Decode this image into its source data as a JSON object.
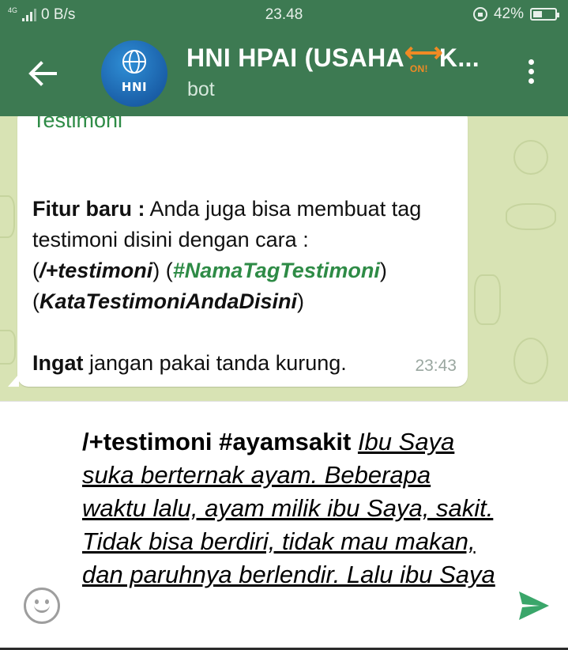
{
  "status_bar": {
    "network": "4G",
    "data_rate": "0 B/s",
    "time": "23.48",
    "battery": "42%",
    "battery_level": 0.42
  },
  "toolbar": {
    "title_before": "HNI HPAI (USAHA",
    "title_badge": "ON!",
    "title_after": "K...",
    "subtitle": "bot",
    "avatar_text": "HNI"
  },
  "message": {
    "heading": "Testimoni",
    "feature_label": "Fitur baru :",
    "feature_text": " Anda juga bisa membuat tag testimoni disini dengan cara :",
    "format_cmd": "/+testimoni",
    "format_tag": "#NamaTagTestimoni",
    "format_text": "KataTestimoniAndaDisini",
    "reminder_label": "Ingat",
    "reminder_text": " jangan pakai tanda kurung.",
    "time": "23:43"
  },
  "composer": {
    "command": "/+testimoni #ayamsakit",
    "story": "Ibu Saya suka berternak ayam. Beberapa waktu lalu, ayam milik ibu Saya, sakit. Tidak bisa berdiri, tidak mau makan, dan paruhnya berlendir. Lalu ibu Saya"
  },
  "colors": {
    "header": "#3d7a52",
    "accent": "#2e8b46",
    "chat_background": "#d8e3b4",
    "send": "#3aa66a"
  }
}
